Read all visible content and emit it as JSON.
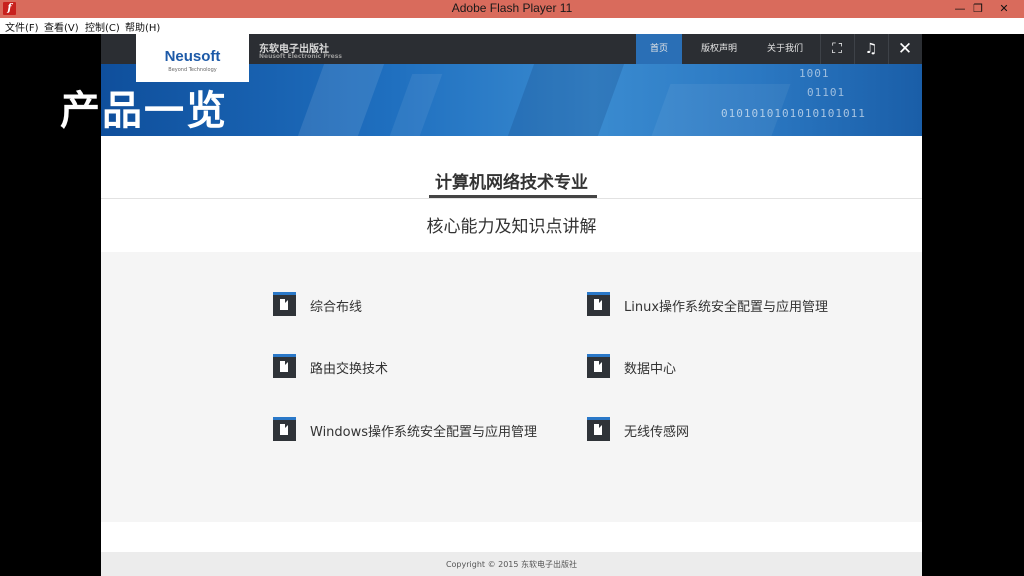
{
  "window": {
    "title": "Adobe Flash Player 11",
    "icon": "flash-icon",
    "minimize_glyph": "—",
    "maximize_glyph": "❐",
    "close_glyph": "✕"
  },
  "menubar": {
    "items": [
      "文件(F)",
      "查看(V)",
      "控制(C)",
      "帮助(H)"
    ]
  },
  "logo": {
    "name": "Neusoft",
    "tagline": "Beyond Technology"
  },
  "publisher": {
    "name_cn": "东软电子出版社",
    "name_en": "Neusoft Electronic Press"
  },
  "nav": {
    "home": "首页",
    "copyright": "版权声明",
    "about": "关于我们",
    "icons": {
      "fullscreen": "⛶",
      "music": "♫",
      "close": "✕",
      "phone": "✆"
    }
  },
  "banner": {
    "page_title": "产品一览",
    "binary_lines": [
      "1001",
      "01101",
      "0101010101010101011"
    ],
    "colors": {
      "primary": "#1f6fbf",
      "accent": "#2a6fb6"
    }
  },
  "content": {
    "main_heading": "计算机网络技术专业",
    "sub_heading": "核心能力及知识点讲解",
    "items": [
      "综合布线",
      "Linux操作系统安全配置与应用管理",
      "路由交换技术",
      "数据中心",
      "Windows操作系统安全配置与应用管理",
      "无线传感网"
    ]
  },
  "footer": {
    "text": "Copyright © 2015   东软电子出版社"
  }
}
